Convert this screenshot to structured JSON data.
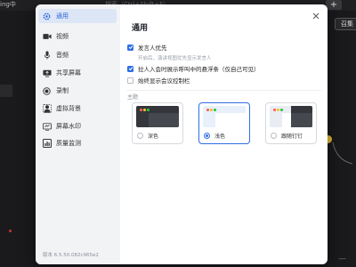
{
  "background": {
    "top_left_text": "ing中",
    "search_text": "搜索（Ctrl+Shift+F）",
    "plus_label": "+",
    "right_button_label": "召集",
    "minus_label": "—"
  },
  "sidebar": {
    "items": [
      {
        "label": "通用",
        "icon": "gear-icon",
        "active": true
      },
      {
        "label": "视频",
        "icon": "camera-icon",
        "active": false
      },
      {
        "label": "音频",
        "icon": "mic-icon",
        "active": false
      },
      {
        "label": "共享屏幕",
        "icon": "screen-share-icon",
        "active": false
      },
      {
        "label": "录制",
        "icon": "record-icon",
        "active": false
      },
      {
        "label": "虚拟背景",
        "icon": "virtual-background-icon",
        "active": false
      },
      {
        "label": "屏幕水印",
        "icon": "watermark-icon",
        "active": false
      },
      {
        "label": "质量监测",
        "icon": "quality-monitor-icon",
        "active": false
      }
    ],
    "version": "版本 6.5.50.082c965e2"
  },
  "content": {
    "title": "通用",
    "options": [
      {
        "label": "发言人优先",
        "checked": true
      },
      {
        "label": "拉人入会时展示呼叫中的悬浮条（仅自己可见）",
        "checked": true
      },
      {
        "label": "始终显示会议控制栏",
        "checked": false
      }
    ],
    "speaker_note": "开启后，演讲视图优先显示发言人",
    "theme_section": "主题",
    "themes": [
      {
        "label": "深色",
        "selected": false
      },
      {
        "label": "浅色",
        "selected": true
      },
      {
        "label": "跟随钉钉",
        "selected": false
      }
    ]
  },
  "colors": {
    "accent": "#2f6fe4",
    "sidebar_bg": "#f2f3f5",
    "active_item_bg": "#dce6f7"
  }
}
